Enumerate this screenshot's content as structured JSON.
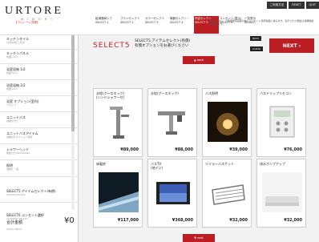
{
  "header": {
    "logo": "URTORE",
    "logo_sub": "M I D O R I",
    "logo_ja": "【ウルトーレ見積】",
    "steps": [
      {
        "label1": "給湯器導入で",
        "label2": "SELECT 1"
      },
      {
        "label1": "プランセレクト",
        "label2": "SELECT 2"
      },
      {
        "label1": "カラーセレクト",
        "label2": "SELECT 3"
      },
      {
        "label1": "機器セレクト・",
        "label2": "SELECT 4"
      },
      {
        "label1": "内容セレクト",
        "label2": "SELECT 5"
      },
      {
        "label1": "コンセント(表示)",
        "label2": "SELECT 6"
      },
      {
        "label1": "一覧表示",
        "label2": "RESULT"
      }
    ],
    "top_buttons": [
      "ご利用方法",
      "RESET",
      "QUIT"
    ]
  },
  "sidebar": {
    "items": [
      {
        "label": "キッチンタイル",
        "sub": "(お客様施工方法)"
      },
      {
        "label": "キッチンパネル",
        "sub": "前面パネル"
      },
      {
        "label": "浴室収納 1/2",
        "sub": "前面30cm"
      },
      {
        "label": "浴室収納 2/2",
        "sub": "前面30cm"
      },
      {
        "label": "浴室 オプション(室内)",
        "sub": "フタイプ"
      },
      {
        "label": "ユニットバス",
        "sub": "(機能付き)"
      },
      {
        "label": "ユニットバスアイテム",
        "sub": "(機能付)オプション項目"
      },
      {
        "label": "シャワーヘッド",
        "sub": "機能付きGRAFADINA"
      },
      {
        "label": "照明",
        "sub": "(機能) 一般"
      },
      {
        "label": "SELECT5 アイテムセレクト(有償)",
        "sub": "OPTION SELECT"
      },
      {
        "label": "SELECT6 コンセント選択",
        "sub": "CONSENT SELECT"
      }
    ],
    "total_label": "合計金額",
    "total_sub": "TOTAL PRICE",
    "total_value": "¥0"
  },
  "main": {
    "select_label": "SELECT5",
    "title_line1": "SELECT5 アイテムセレクト(有償)",
    "title_line2": "有償オプションをお選びください",
    "back_small": "BACK",
    "clear_small": "CLEAR",
    "next_label": "NEXT",
    "note": "※右記「次へ」で最終確認画面の前にコンセント選択画面に進みます。表示された価格は消費税抜きの価格です。",
    "back_bar": "▲ back",
    "next_bar": "▼ next",
    "cards": [
      {
        "name": "水栓(グースネック)",
        "sub": "(ハンドシャワー付)",
        "price": "¥89,000"
      },
      {
        "name": "水栓(グースネック)",
        "sub": "",
        "price": "¥88,000"
      },
      {
        "name": "バス照明",
        "sub": "",
        "price": "¥39,000"
      },
      {
        "name": "バスドリップリモコン",
        "sub": "",
        "price": "¥76,000"
      },
      {
        "name": "床暖房",
        "sub": "",
        "price": "¥117,000"
      },
      {
        "name": "バスTV",
        "sub": "(地デジ)",
        "price": "¥368,000"
      },
      {
        "name": "ツイラーバスケット",
        "sub": "",
        "price": "¥32,000"
      },
      {
        "name": "排水ポンプアップ",
        "sub": "",
        "price": "¥32,000"
      }
    ]
  }
}
